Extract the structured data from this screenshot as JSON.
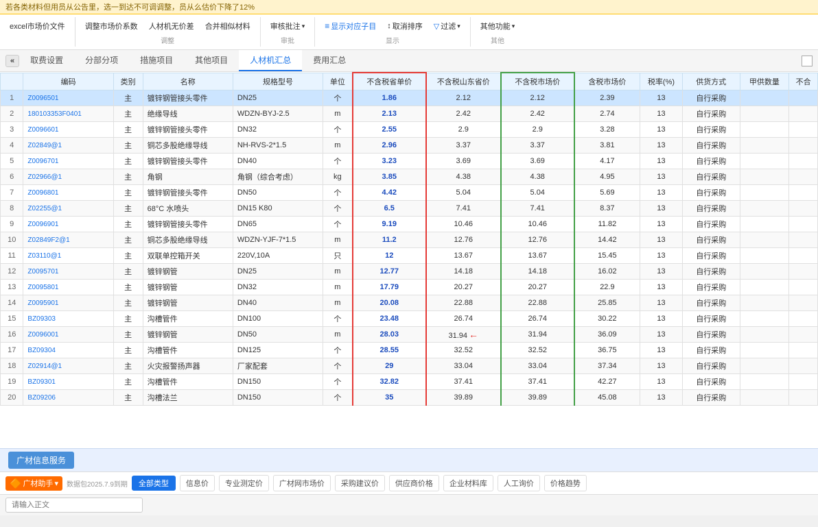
{
  "banner": {
    "text": "若各类材料但用员从公告里，选一到达不可调调整，员从么估价下降了12%"
  },
  "toolbar": {
    "groups": [
      {
        "label": "",
        "buttons": [
          {
            "text": "excel市场价文件",
            "arrow": false
          }
        ]
      },
      {
        "label": "调整",
        "buttons": [
          {
            "text": "调整市场价系数",
            "arrow": false
          },
          {
            "text": "人材机无价差",
            "arrow": false
          },
          {
            "text": "合并相似材料",
            "arrow": false
          }
        ]
      },
      {
        "label": "审批",
        "buttons": [
          {
            "text": "审核批注",
            "arrow": true
          }
        ]
      },
      {
        "label": "显示",
        "buttons": [
          {
            "text": "显示对应子目",
            "arrow": false
          },
          {
            "text": "取消排序",
            "arrow": false
          },
          {
            "text": "过滤",
            "arrow": true
          }
        ]
      },
      {
        "label": "其他",
        "buttons": [
          {
            "text": "其他功能",
            "arrow": true
          }
        ]
      }
    ]
  },
  "tabs": {
    "items": [
      {
        "label": "取费设置",
        "active": false
      },
      {
        "label": "分部分项",
        "active": false
      },
      {
        "label": "措施项目",
        "active": false
      },
      {
        "label": "其他项目",
        "active": false
      },
      {
        "label": "人材机汇总",
        "active": true
      },
      {
        "label": "费用汇总",
        "active": false
      }
    ]
  },
  "table": {
    "headers": [
      "编码",
      "类别",
      "名称",
      "规格型号",
      "单位",
      "不含税省单价",
      "不含税山东省价",
      "不含税市场价",
      "含税市场价",
      "税率(%)",
      "供货方式",
      "甲供数量",
      "不合"
    ],
    "rows": [
      {
        "num": 1,
        "code": "Z0096501",
        "type": "主",
        "name": "镀锌钢管接头零件",
        "spec": "DN25",
        "unit": "个",
        "price1": "1.86",
        "price2": "2.12",
        "price3": "2.12",
        "price4": "2.39",
        "tax": "13",
        "supply": "自行采购",
        "qty": ""
      },
      {
        "num": 2,
        "code": "180103353F0401",
        "type": "主",
        "name": "绝缘导线",
        "spec": "WDZN-BYJ-2.5",
        "unit": "m",
        "price1": "2.13",
        "price2": "2.42",
        "price3": "2.42",
        "price4": "2.74",
        "tax": "13",
        "supply": "自行采购",
        "qty": ""
      },
      {
        "num": 3,
        "code": "Z0096601",
        "type": "主",
        "name": "镀锌钢管接头零件",
        "spec": "DN32",
        "unit": "个",
        "price1": "2.55",
        "price2": "2.9",
        "price3": "2.9",
        "price4": "3.28",
        "tax": "13",
        "supply": "自行采购",
        "qty": ""
      },
      {
        "num": 4,
        "code": "Z02849@1",
        "type": "主",
        "name": "铜芯多股绝缘导线",
        "spec": "NH-RVS-2*1.5",
        "unit": "m",
        "price1": "2.96",
        "price2": "3.37",
        "price3": "3.37",
        "price4": "3.81",
        "tax": "13",
        "supply": "自行采购",
        "qty": ""
      },
      {
        "num": 5,
        "code": "Z0096701",
        "type": "主",
        "name": "镀锌钢管接头零件",
        "spec": "DN40",
        "unit": "个",
        "price1": "3.23",
        "price2": "3.69",
        "price3": "3.69",
        "price4": "4.17",
        "tax": "13",
        "supply": "自行采购",
        "qty": ""
      },
      {
        "num": 6,
        "code": "Z02966@1",
        "type": "主",
        "name": "角钢",
        "spec": "角钢（综合考虑）",
        "unit": "kg",
        "price1": "3.85",
        "price2": "4.38",
        "price3": "4.38",
        "price4": "4.95",
        "tax": "13",
        "supply": "自行采购",
        "qty": ""
      },
      {
        "num": 7,
        "code": "Z0096801",
        "type": "主",
        "name": "镀锌钢管接头零件",
        "spec": "DN50",
        "unit": "个",
        "price1": "4.42",
        "price2": "5.04",
        "price3": "5.04",
        "price4": "5.69",
        "tax": "13",
        "supply": "自行采购",
        "qty": ""
      },
      {
        "num": 8,
        "code": "Z02255@1",
        "type": "主",
        "name": "68°C 水喷头",
        "spec": "DN15 K80",
        "unit": "个",
        "price1": "6.5",
        "price2": "7.41",
        "price3": "7.41",
        "price4": "8.37",
        "tax": "13",
        "supply": "自行采购",
        "qty": ""
      },
      {
        "num": 9,
        "code": "Z0096901",
        "type": "主",
        "name": "镀锌钢管接头零件",
        "spec": "DN65",
        "unit": "个",
        "price1": "9.19",
        "price2": "10.46",
        "price3": "10.46",
        "price4": "11.82",
        "tax": "13",
        "supply": "自行采购",
        "qty": ""
      },
      {
        "num": 10,
        "code": "Z02849F2@1",
        "type": "主",
        "name": "铜芯多股绝缘导线",
        "spec": "WDZN-YJF-7*1.5",
        "unit": "m",
        "price1": "11.2",
        "price2": "12.76",
        "price3": "12.76",
        "price4": "14.42",
        "tax": "13",
        "supply": "自行采购",
        "qty": ""
      },
      {
        "num": 11,
        "code": "Z03110@1",
        "type": "主",
        "name": "双联单控箱开关",
        "spec": "220V,10A",
        "unit": "只",
        "price1": "12",
        "price2": "13.67",
        "price3": "13.67",
        "price4": "15.45",
        "tax": "13",
        "supply": "自行采购",
        "qty": ""
      },
      {
        "num": 12,
        "code": "Z0095701",
        "type": "主",
        "name": "镀锌钢管",
        "spec": "DN25",
        "unit": "m",
        "price1": "12.77",
        "price2": "14.18",
        "price3": "14.18",
        "price4": "16.02",
        "tax": "13",
        "supply": "自行采购",
        "qty": ""
      },
      {
        "num": 13,
        "code": "Z0095801",
        "type": "主",
        "name": "镀锌钢管",
        "spec": "DN32",
        "unit": "m",
        "price1": "17.79",
        "price2": "20.27",
        "price3": "20.27",
        "price4": "22.9",
        "tax": "13",
        "supply": "自行采购",
        "qty": ""
      },
      {
        "num": 14,
        "code": "Z0095901",
        "type": "主",
        "name": "镀锌钢管",
        "spec": "DN40",
        "unit": "m",
        "price1": "20.08",
        "price2": "22.88",
        "price3": "22.88",
        "price4": "25.85",
        "tax": "13",
        "supply": "自行采购",
        "qty": ""
      },
      {
        "num": 15,
        "code": "BZ09303",
        "type": "主",
        "name": "沟槽管件",
        "spec": "DN100",
        "unit": "个",
        "price1": "23.48",
        "price2": "26.74",
        "price3": "26.74",
        "price4": "30.22",
        "tax": "13",
        "supply": "自行采购",
        "qty": ""
      },
      {
        "num": 16,
        "code": "Z0096001",
        "type": "主",
        "name": "镀锌钢管",
        "spec": "DN50",
        "unit": "m",
        "price1": "28.03",
        "price2": "31.94",
        "price3": "31.94",
        "price4": "36.09",
        "tax": "13",
        "supply": "自行采购",
        "qty": ""
      },
      {
        "num": 17,
        "code": "BZ09304",
        "type": "主",
        "name": "沟槽管件",
        "spec": "DN125",
        "unit": "个",
        "price1": "28.55",
        "price2": "32.52",
        "price3": "32.52",
        "price4": "36.75",
        "tax": "13",
        "supply": "自行采购",
        "qty": ""
      },
      {
        "num": 18,
        "code": "Z02914@1",
        "type": "主",
        "name": "火灾报警扬声器",
        "spec": "厂家配套",
        "unit": "个",
        "price1": "29",
        "price2": "33.04",
        "price3": "33.04",
        "price4": "37.34",
        "tax": "13",
        "supply": "自行采购",
        "qty": ""
      },
      {
        "num": 19,
        "code": "BZ09301",
        "type": "主",
        "name": "沟槽管件",
        "spec": "DN150",
        "unit": "个",
        "price1": "32.82",
        "price2": "37.41",
        "price3": "37.41",
        "price4": "42.27",
        "tax": "13",
        "supply": "自行采购",
        "qty": ""
      },
      {
        "num": 20,
        "code": "BZ09206",
        "type": "主",
        "name": "沟槽法兰",
        "spec": "DN150",
        "unit": "个",
        "price1": "35",
        "price2": "39.89",
        "price3": "39.89",
        "price4": "45.08",
        "tax": "13",
        "supply": "自行采购",
        "qty": ""
      }
    ]
  },
  "bottom": {
    "service_label": "广材信息服务"
  },
  "guangcai": {
    "logo_text": "广材助手",
    "date_text": "数据包2025.7.9到期",
    "all_type": "全部类型",
    "tabs": [
      "信息价",
      "专业测定价",
      "广材网市场价",
      "采购建议价",
      "供应商价格",
      "企业材料库",
      "人工询价",
      "价格趋势"
    ]
  },
  "input": {
    "placeholder": "请输入正文"
  }
}
